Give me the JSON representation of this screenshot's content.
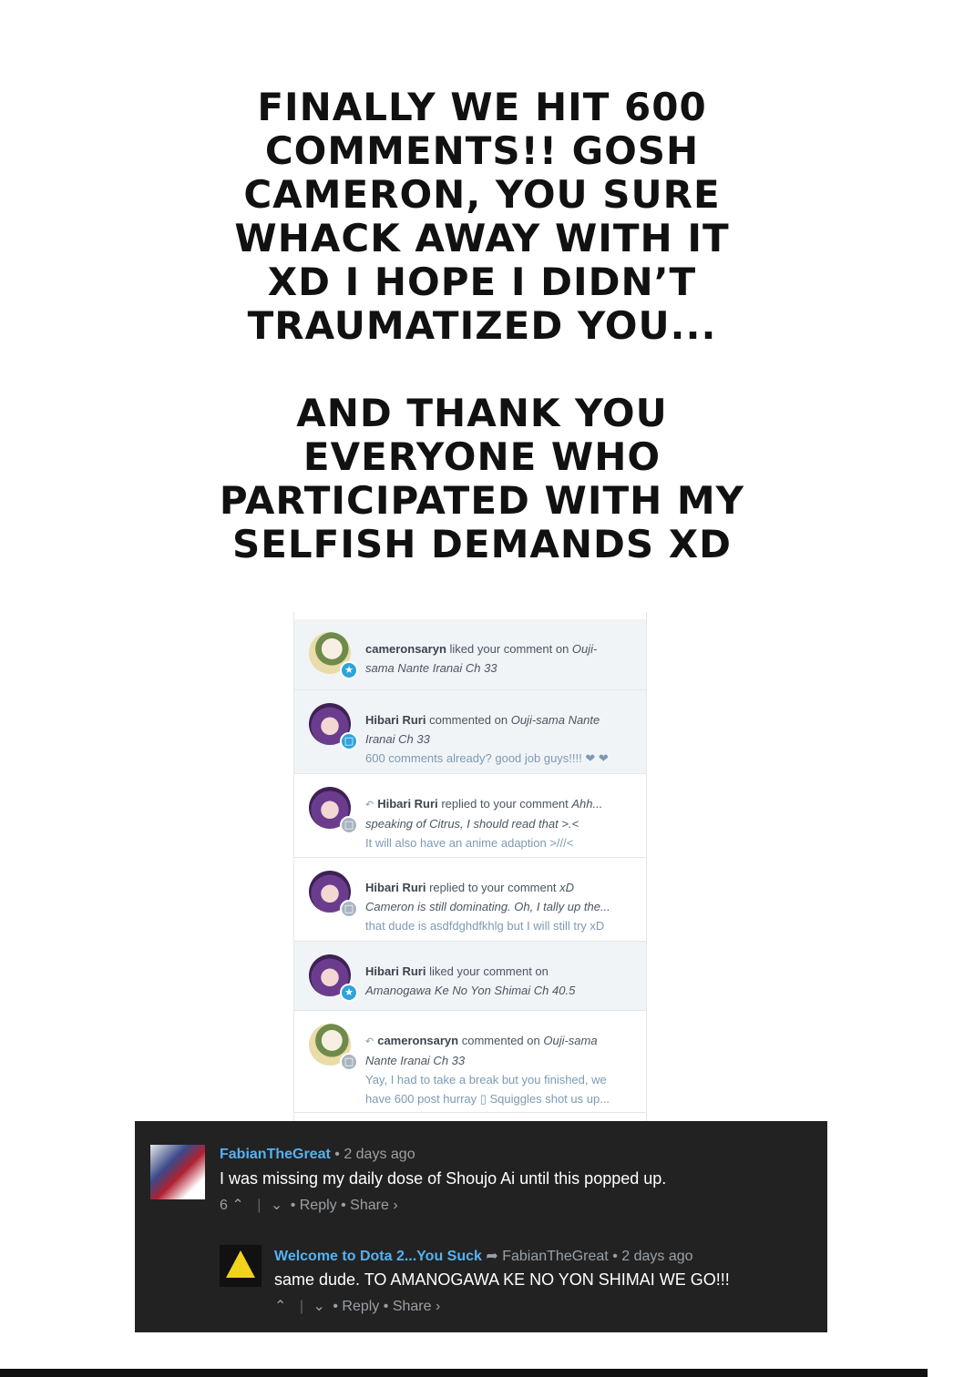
{
  "headline": {
    "part1": "FINALLY WE HIT 600 COMMENTS!! GOSH CAMERON, YOU SURE WHACK AWAY WITH IT XD I HOPE I DIDN’T TRAUMATIZED YOU...",
    "part2": "AND THANK YOU EVERYONE WHO PARTICIPATED WITH MY SELFISH DEMANDS XD"
  },
  "notifications": [
    {
      "user": "cameronsaryn",
      "action": "liked your comment on",
      "title_line1": "Ouji-",
      "title_line2": "sama Nante Iranai Ch 33",
      "badge": "★"
    },
    {
      "user": "Hibari Ruri",
      "action": "commented on",
      "title_line1": "Ouji-sama Nante",
      "title_line2": "Iranai Ch 33",
      "preview": "600 comments already? good job guys!!!! ❤ ❤",
      "badge": "💬"
    },
    {
      "user": "Hibari Ruri",
      "action": "replied to your comment",
      "title_line1": "Ahh...",
      "title_line2": "speaking of Citrus, I should read that >.<",
      "preview": "It will also have an anime adaption >///<",
      "badge": "💬"
    },
    {
      "user": "Hibari Ruri",
      "action": "replied to your comment",
      "title_line1": "xD",
      "title_line2": "Cameron is still dominating. Oh, I tally up the...",
      "preview": "that dude is asdfdghdfkhlg but I will still try xD",
      "badge": "💬"
    },
    {
      "user": "Hibari Ruri",
      "action": "liked your comment on",
      "title_line2": "Amanogawa Ke No Yon Shimai Ch 40.5",
      "badge": "★"
    },
    {
      "user": "cameronsaryn",
      "action": "commented on",
      "title_line1": "Ouji-sama",
      "title_line2": "Nante Iranai Ch 33",
      "preview1": "Yay, I had to take a break but you finished, we",
      "preview2": "have 600 post hurray ▯ Squiggles shot us up...",
      "badge": "💬"
    }
  ],
  "comments": [
    {
      "author": "FabianTheGreat",
      "time": "• 2 days ago",
      "body": "I was missing my daily dose of Shoujo Ai until this popped up.",
      "votes": "6",
      "reply": "Reply",
      "share": "Share ›"
    },
    {
      "author": "Welcome to Dota 2...You Suck",
      "reply_to": "FabianTheGreat",
      "time": "• 2 days ago",
      "body": "same dude. TO AMANOGAWA KE NO YON SHIMAI WE GO!!!",
      "reply": "Reply",
      "share": "Share ›"
    }
  ],
  "colors": {
    "author_link": "#55b1f2",
    "comment_bg": "#222222",
    "notif_unread_bg": "#f1f4f7",
    "badge_blue": "#2ea3dd"
  }
}
